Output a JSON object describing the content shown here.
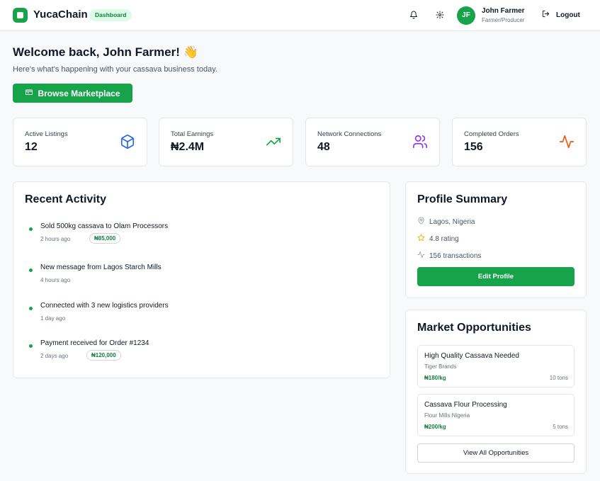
{
  "header": {
    "brand": "YucaChain",
    "badge": "Dashboard",
    "icons": [
      "bell-icon",
      "gear-icon",
      "logout-icon"
    ],
    "user": {
      "initials": "JF",
      "name": "John Farmer",
      "role": "Farmer/Producer"
    },
    "logout_label": "Logout"
  },
  "welcome": {
    "title": "Welcome back, John Farmer! 👋",
    "subtitle": "Here's what's happening with your cassava business today.",
    "browse_label": "Browse Marketplace"
  },
  "stats": [
    {
      "label": "Active Listings",
      "value": "12",
      "icon": "package-icon",
      "color": "#2563eb"
    },
    {
      "label": "Total Earnings",
      "value": "₦2.4M",
      "icon": "trending-up-icon",
      "color": "#16a34a"
    },
    {
      "label": "Network Connections",
      "value": "48",
      "icon": "users-icon",
      "color": "#9333ea"
    },
    {
      "label": "Completed Orders",
      "value": "156",
      "icon": "activity-icon",
      "color": "#ea580c"
    }
  ],
  "recent_activity": {
    "title": "Recent Activity",
    "items": [
      {
        "title": "Sold 500kg cassava to Olam Processors",
        "time": "2 hours ago",
        "amount": "₦85,000"
      },
      {
        "title": "New message from Lagos Starch Mills",
        "time": "4 hours ago",
        "amount": ""
      },
      {
        "title": "Connected with 3 new logistics providers",
        "time": "1 day ago",
        "amount": ""
      },
      {
        "title": "Payment received for Order #1234",
        "time": "2 days ago",
        "amount": "₦120,000"
      }
    ]
  },
  "profile_summary": {
    "title": "Profile Summary",
    "location": "Lagos, Nigeria",
    "rating": "4.8 rating",
    "transactions": "156 transactions",
    "edit_label": "Edit Profile"
  },
  "market_opportunities": {
    "title": "Market Opportunities",
    "items": [
      {
        "title": "High Quality Cassava Needed",
        "company": "Tiger Brands",
        "price": "₦180/kg",
        "quantity": "10 tons"
      },
      {
        "title": "Cassava Flour Processing",
        "company": "Flour Mills Nigeria",
        "price": "₦200/kg",
        "quantity": "5 tons"
      }
    ],
    "view_all_label": "View All Opportunities"
  },
  "colors": {
    "brand": "#16a34a",
    "accent_light": "#dcfce7"
  }
}
